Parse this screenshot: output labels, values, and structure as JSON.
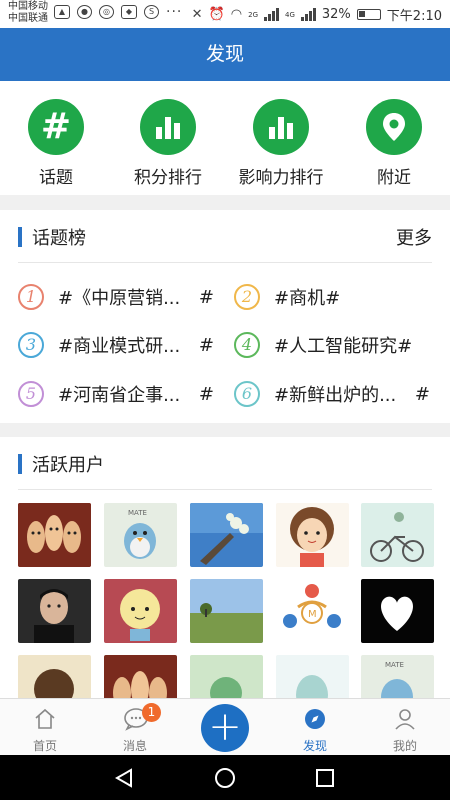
{
  "statusbar": {
    "carrier1": "中国移动",
    "carrier2": "中国联通",
    "net1": "2G",
    "net2": "4G",
    "battery": "32%",
    "time": "下午2:10",
    "more": "···"
  },
  "header": {
    "title": "发现"
  },
  "quick": [
    {
      "label": "话题",
      "icon": "hash-icon"
    },
    {
      "label": "积分排行",
      "icon": "bar-chart-icon"
    },
    {
      "label": "影响力排行",
      "icon": "bar-chart-icon"
    },
    {
      "label": "附近",
      "icon": "location-pin-icon"
    }
  ],
  "topics": {
    "title": "话题榜",
    "more": "更多",
    "items": [
      {
        "rank": "1",
        "name": "#《中原营销...",
        "tail": "#",
        "color": "#e8826e"
      },
      {
        "rank": "2",
        "name": "#商机#",
        "tail": "",
        "color": "#f0b74a"
      },
      {
        "rank": "3",
        "name": "#商业模式研...",
        "tail": "#",
        "color": "#4aa8d8"
      },
      {
        "rank": "4",
        "name": "#人工智能研究#",
        "tail": "",
        "color": "#5cb85c"
      },
      {
        "rank": "5",
        "name": "#河南省企事...",
        "tail": "#",
        "color": "#c18fd6"
      },
      {
        "rank": "6",
        "name": "#新鲜出炉的...",
        "tail": "#",
        "color": "#6cc5c9"
      }
    ]
  },
  "users": {
    "title": "活跃用户"
  },
  "tabs": [
    {
      "label": "首页",
      "icon": "home-icon"
    },
    {
      "label": "消息",
      "icon": "message-icon",
      "badge": "1"
    },
    {
      "label": "",
      "icon": "plus-icon"
    },
    {
      "label": "发现",
      "icon": "compass-icon"
    },
    {
      "label": "我的",
      "icon": "person-icon"
    }
  ],
  "colors": {
    "primary": "#2a73c5",
    "green": "#1fa749",
    "badge": "#f06a2c"
  }
}
